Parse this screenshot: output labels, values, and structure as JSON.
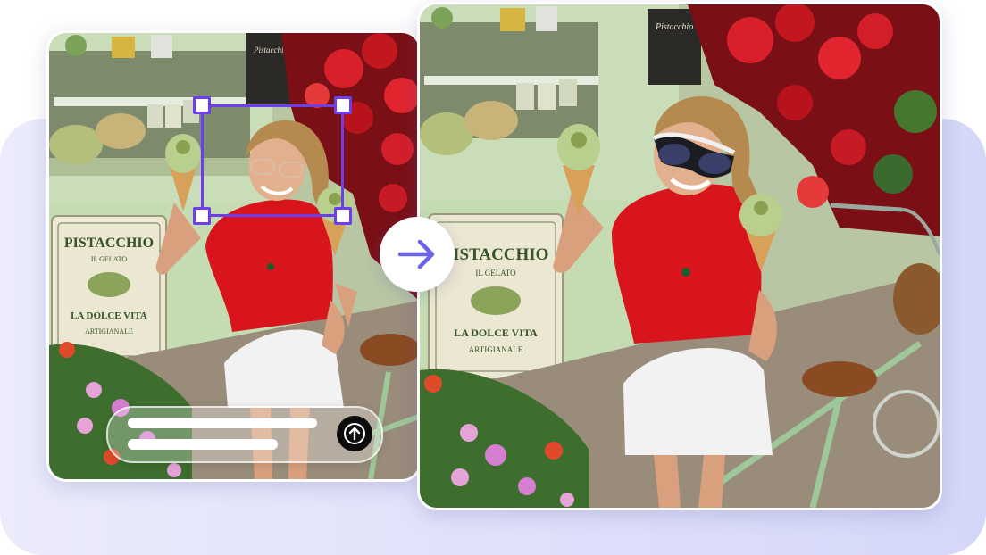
{
  "scene": {
    "sign_lines": [
      "PISTACCHIO",
      "IL GELATO",
      "LA DOLCE VITA",
      "ARTIGIANALE"
    ],
    "board_text": "Pistacchio"
  },
  "edit_tool": {
    "selection_tool": "resize-selection",
    "prompt_placeholder_lines": 2,
    "send_icon": "arrow-up-icon"
  },
  "transition": {
    "icon": "arrow-right-icon"
  },
  "colors": {
    "accent": "#6d3df0",
    "arrow": "#6b63e8",
    "shirt": "#d8141c",
    "gelato": "#b8cf8e",
    "storefront": "#cfe3bd"
  }
}
